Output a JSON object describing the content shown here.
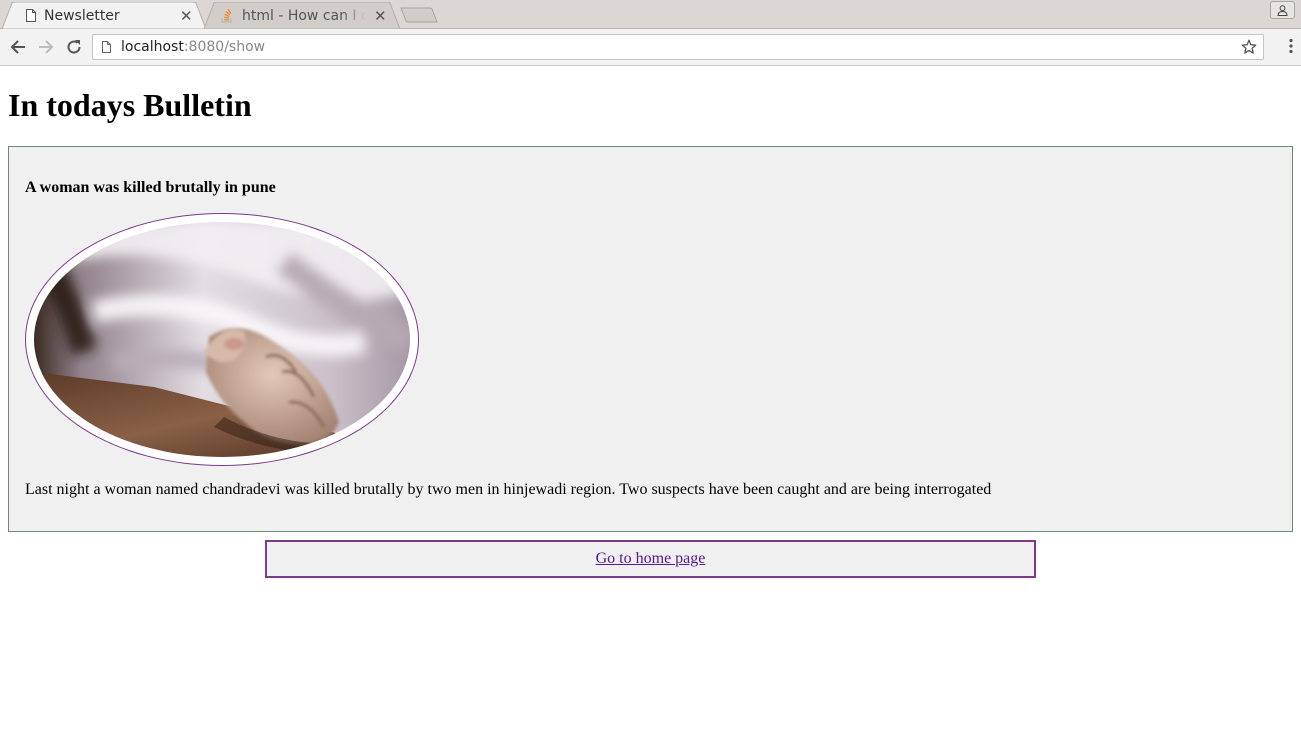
{
  "browser": {
    "tabs": [
      {
        "title": "Newsletter",
        "icon": "page-icon",
        "active": true
      },
      {
        "title": "html - How can I dis",
        "icon": "stackoverflow-icon",
        "active": false
      }
    ],
    "address": {
      "host": "localhost",
      "path": ":8080/show"
    }
  },
  "page": {
    "title": "In todays Bulletin",
    "article": {
      "headline": "A woman was killed brutally in pune",
      "image": "oval-framed-photo",
      "body": "Last night a woman named chandradevi was killed brutally by two men in hinjewadi region. Two suspects have been caught and are being interrogated"
    },
    "home_link": "Go to home page"
  },
  "colors": {
    "frame_border": "#7b3a8a",
    "article_border": "#6a8a76",
    "article_bg": "#f0f0f0",
    "link_visited": "#551a8b"
  }
}
